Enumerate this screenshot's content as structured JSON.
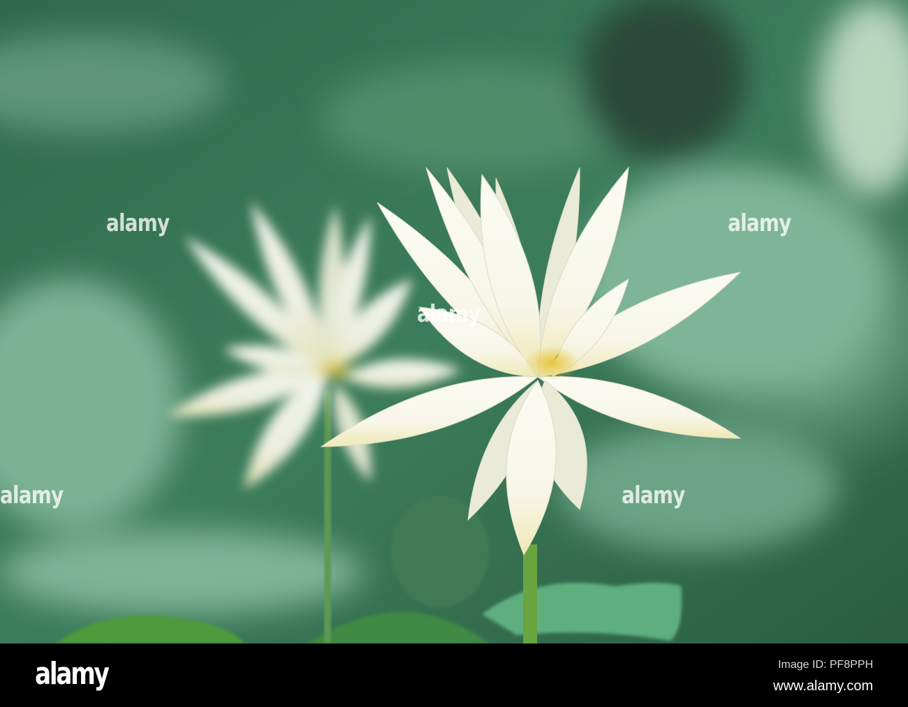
{
  "photo": {
    "subject": "white lotus flowers",
    "colors": {
      "background": "#3e7a5a",
      "leaf": "#8fc3a4",
      "petal": "#f6f5e6",
      "center": "#e8c84a"
    }
  },
  "watermark": {
    "text": "alamy"
  },
  "footer": {
    "logo": "alamy",
    "image_id": "Image ID: PF8PPH",
    "website": "www.alamy.com"
  }
}
